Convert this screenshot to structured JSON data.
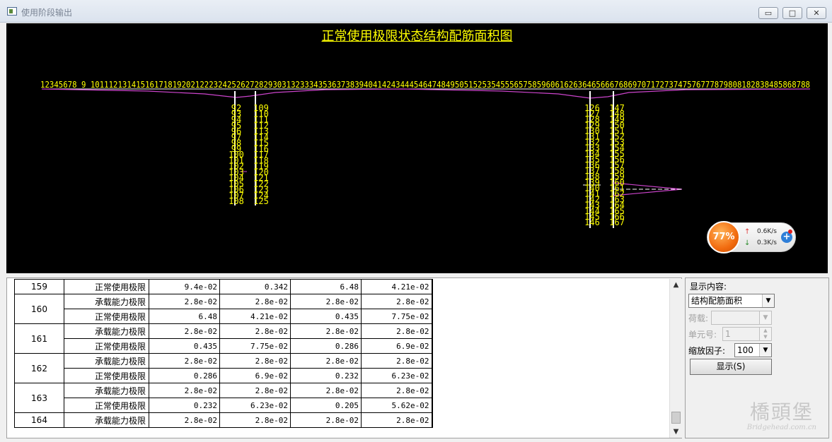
{
  "window": {
    "title": "使用阶段输出",
    "controls": {
      "minimize": "▭",
      "maximize": "□",
      "close": "✕"
    }
  },
  "chart": {
    "title": "正常使用极限状态结构配筋面积图",
    "node_labels": "12345678 9 10111213141516171819202122232425262728293031323334353637383940414243444546474849505152535455565758596061626364656667686970717273747576777879808182838485868788",
    "pier_labels": {
      "pier1_left": [
        "92",
        "93",
        "94",
        "95",
        "96",
        "97",
        "98",
        "99",
        "100",
        "101",
        "102",
        "103",
        "104",
        "105",
        "106",
        "107",
        "108"
      ],
      "pier1_right": [
        "109",
        "110",
        "111",
        "112",
        "113",
        "114",
        "115",
        "116",
        "117",
        "118",
        "119",
        "120",
        "121",
        "122",
        "123",
        "124",
        "125"
      ],
      "pier2_left": [
        "126",
        "127",
        "128",
        "129",
        "130",
        "131",
        "132",
        "133",
        "134",
        "135",
        "136",
        "137",
        "138",
        "139",
        "140",
        "141",
        "142",
        "143",
        "144",
        "145",
        "146"
      ],
      "pier2_right": [
        "147",
        "148",
        "149",
        "150",
        "151",
        "152",
        "153",
        "154",
        "155",
        "156",
        "157",
        "158",
        "159",
        "160",
        "161",
        "162",
        "163",
        "164",
        "165",
        "166",
        "167"
      ]
    },
    "colors": {
      "background": "#000000",
      "labels": "#ffff00",
      "diagram": "#cc44cc",
      "members": "#ffffff"
    }
  },
  "network_widget": {
    "percent": "77%",
    "upload": "0.6K/s",
    "download": "0.3K/s",
    "up_icon": "↑",
    "down_icon": "↓",
    "plus": "+"
  },
  "table": {
    "rows": [
      {
        "id": "159",
        "type": "正常使用极限",
        "v": [
          "9.4e-02",
          "0.342",
          "6.48",
          "4.21e-02"
        ]
      },
      {
        "id": "160",
        "type": "承载能力极限",
        "v": [
          "2.8e-02",
          "2.8e-02",
          "2.8e-02",
          "2.8e-02"
        ]
      },
      {
        "id": "",
        "type": "正常使用极限",
        "v": [
          "6.48",
          "4.21e-02",
          "0.435",
          "7.75e-02"
        ]
      },
      {
        "id": "161",
        "type": "承载能力极限",
        "v": [
          "2.8e-02",
          "2.8e-02",
          "2.8e-02",
          "2.8e-02"
        ]
      },
      {
        "id": "",
        "type": "正常使用极限",
        "v": [
          "0.435",
          "7.75e-02",
          "0.286",
          "6.9e-02"
        ]
      },
      {
        "id": "162",
        "type": "承载能力极限",
        "v": [
          "2.8e-02",
          "2.8e-02",
          "2.8e-02",
          "2.8e-02"
        ]
      },
      {
        "id": "",
        "type": "正常使用极限",
        "v": [
          "0.286",
          "6.9e-02",
          "0.232",
          "6.23e-02"
        ]
      },
      {
        "id": "163",
        "type": "承载能力极限",
        "v": [
          "2.8e-02",
          "2.8e-02",
          "2.8e-02",
          "2.8e-02"
        ]
      },
      {
        "id": "",
        "type": "正常使用极限",
        "v": [
          "0.232",
          "6.23e-02",
          "0.205",
          "5.62e-02"
        ]
      },
      {
        "id": "164",
        "type": "承载能力极限",
        "v": [
          "2.8e-02",
          "2.8e-02",
          "2.8e-02",
          "2.8e-02"
        ]
      }
    ]
  },
  "panel": {
    "display_label": "显示内容:",
    "display_value": "结构配筋面积",
    "load_label": "荷载:",
    "load_value": "",
    "element_label": "单元号:",
    "element_value": "1",
    "scale_label": "缩放因子:",
    "scale_value": "100",
    "show_button": "显示(S)"
  },
  "watermark": {
    "big": "橋頭堡",
    "small": "Bridgehead.com.cn"
  }
}
